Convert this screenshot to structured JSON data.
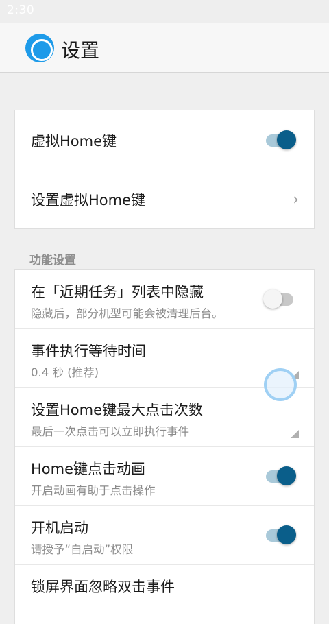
{
  "status_bar": {
    "time": "2:30"
  },
  "app_bar": {
    "title": "设置",
    "logo_icon": "app-logo-circle-icon"
  },
  "main_settings": [
    {
      "title": "虚拟Home键",
      "control": "toggle",
      "state": "on"
    },
    {
      "title": "设置虚拟Home键",
      "control": "chevron",
      "chevron_glyph": "›"
    }
  ],
  "function_section": {
    "header": "功能设置",
    "items": [
      {
        "title": "在「近期任务」列表中隐藏",
        "subtitle": "隐藏后，部分机型可能会被清理后台。",
        "control": "toggle",
        "state": "off"
      },
      {
        "title": "事件执行等待时间",
        "subtitle": "0.4 秒 (推荐)",
        "control": "dropdown"
      },
      {
        "title": "设置Home键最大点击次数",
        "subtitle": "最后一次点击可以立即执行事件",
        "control": "dropdown"
      },
      {
        "title": "Home键点击动画",
        "subtitle": "开启动画有助于点击操作",
        "control": "toggle",
        "state": "on"
      },
      {
        "title": "开机启动",
        "subtitle": "请授予“自启动”权限",
        "control": "toggle",
        "state": "on"
      },
      {
        "title": "锁屏界面忽略双击事件",
        "subtitle": "",
        "control": "none"
      }
    ]
  },
  "colors": {
    "toggle_on_thumb": "#0a5e8a",
    "toggle_on_track": "#a9c9d9",
    "accent_logo": "#1e9be9",
    "floating_button": "#9fd0f4"
  }
}
